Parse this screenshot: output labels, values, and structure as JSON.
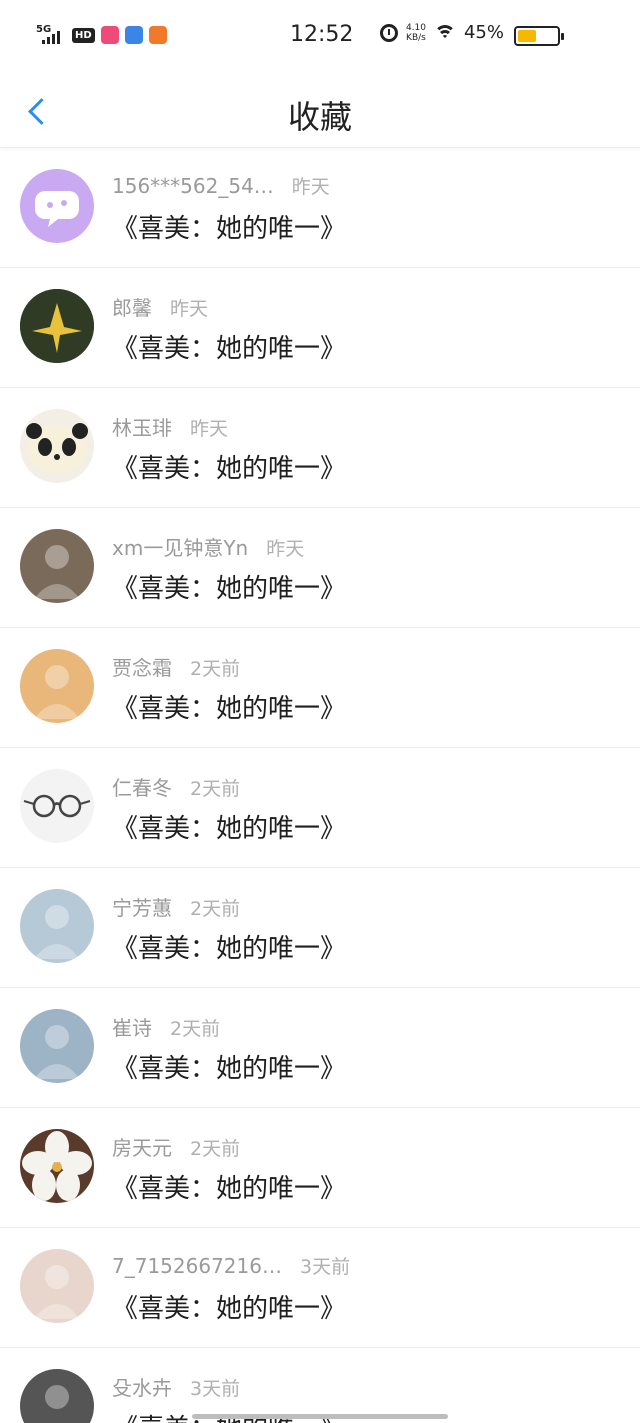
{
  "status_bar": {
    "network": "5G",
    "hd": "HD",
    "time": "12:52",
    "net_speed_value": "4.10",
    "net_speed_unit": "KB/s",
    "battery": "45%",
    "battery_level": 0.45,
    "battery_color": "#f6b900"
  },
  "header": {
    "title": "收藏",
    "back_icon": "chevron-left-icon",
    "accent": "#2a8fea"
  },
  "list": [
    {
      "name": "156***562_54…",
      "time": "昨天",
      "book": "《喜美：她的唯一》",
      "avatar": "chat-bubble",
      "bg": "#c9a9f2"
    },
    {
      "name": "郎馨",
      "time": "昨天",
      "book": "《喜美：她的唯一》",
      "avatar": "origami",
      "bg": "#4a5a3a"
    },
    {
      "name": "林玉琲",
      "time": "昨天",
      "book": "《喜美：她的唯一》",
      "avatar": "panda",
      "bg": "#f3efe6"
    },
    {
      "name": "xm一见钟意Yn",
      "time": "昨天",
      "book": "《喜美：她的唯一》",
      "avatar": "person-photo",
      "bg": "#7a6a5a"
    },
    {
      "name": "贾念霜",
      "time": "2天前",
      "book": "《喜美：她的唯一》",
      "avatar": "portrait",
      "bg": "#e9b77a"
    },
    {
      "name": "仁春冬",
      "time": "2天前",
      "book": "《喜美：她的唯一》",
      "avatar": "glasses",
      "bg": "#f3f3f3"
    },
    {
      "name": "宁芳蕙",
      "time": "2天前",
      "book": "《喜美：她的唯一》",
      "avatar": "sky-girl",
      "bg": "#b6c9d6"
    },
    {
      "name": "崔诗",
      "time": "2天前",
      "book": "《喜美：她的唯一》",
      "avatar": "girl-portrait",
      "bg": "#9db3c6"
    },
    {
      "name": "房天元",
      "time": "2天前",
      "book": "《喜美：她的唯一》",
      "avatar": "white-flower",
      "bg": "#5a3a2a"
    },
    {
      "name": "7_7152667216…",
      "time": "3天前",
      "book": "《喜美：她的唯一》",
      "avatar": "girl-with-cat",
      "bg": "#e8d6cc"
    },
    {
      "name": "殳水卉",
      "time": "3天前",
      "book": "《喜美：她的唯一》",
      "avatar": "dark-portrait",
      "bg": "#555555"
    }
  ]
}
